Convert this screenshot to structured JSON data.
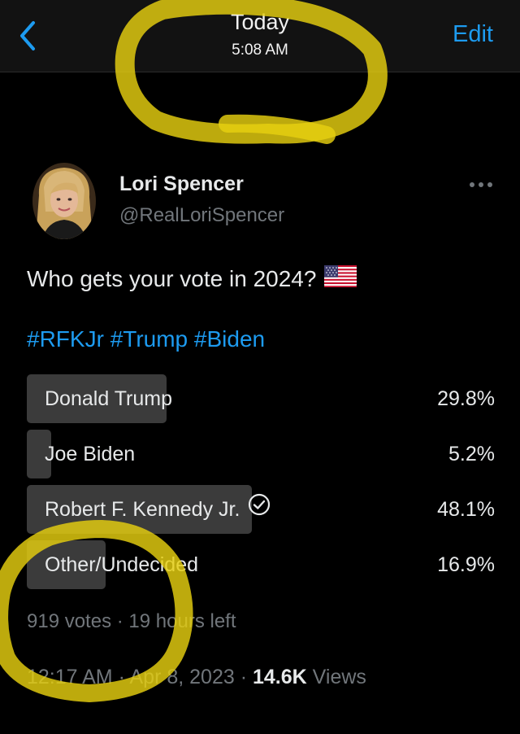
{
  "nav": {
    "title": "Today",
    "subtitle": "5:08 AM",
    "edit_label": "Edit",
    "back_icon": "chevron-left-icon"
  },
  "tweet": {
    "author_name": "Lori Spencer",
    "author_handle": "@RealLoriSpencer",
    "text": "Who gets your vote in 2024?",
    "flag_icon": "us-flag-icon",
    "hashtags": [
      "#RFKJr",
      "#Trump",
      "#Biden"
    ],
    "time": "12:17 AM",
    "date": "Apr 8, 2023",
    "views_count": "14.6K",
    "views_label": "Views"
  },
  "poll": {
    "options": [
      {
        "label": "Donald Trump",
        "percent": "29.8%",
        "value": 29.8
      },
      {
        "label": "Joe Biden",
        "percent": "5.2%",
        "value": 5.2
      },
      {
        "label": "Robert F. Kennedy Jr.",
        "percent": "48.1%",
        "value": 48.1,
        "winner": true
      },
      {
        "label": "Other/Undecided",
        "percent": "16.9%",
        "value": 16.9
      }
    ],
    "votes": "919 votes",
    "time_left": "19 hours left"
  },
  "colors": {
    "accent": "#1d9bf0",
    "background": "#000000",
    "poll_bar": "#3b3b3b",
    "highlight_marker": "#e6d010"
  }
}
